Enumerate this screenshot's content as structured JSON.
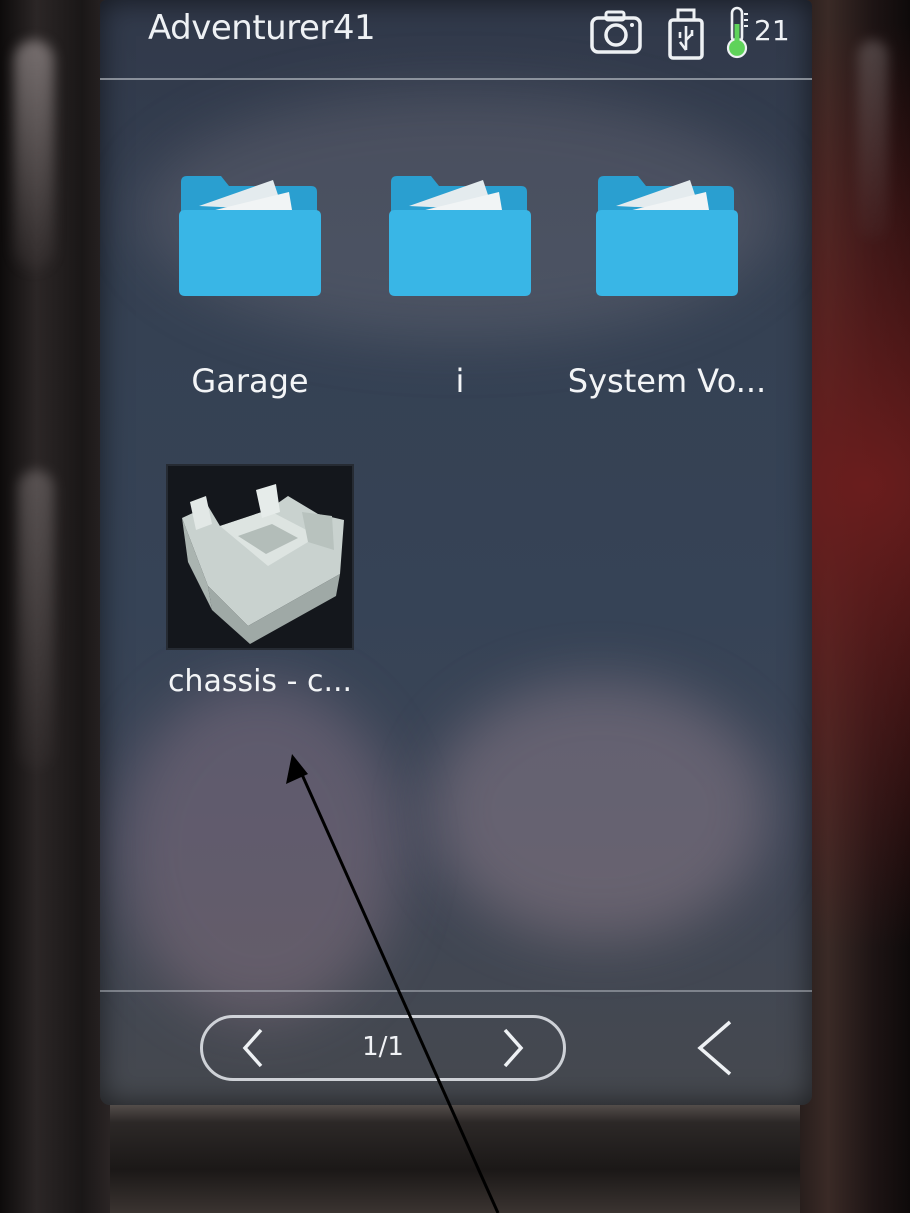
{
  "status_bar": {
    "device_name": "Adventurer41",
    "camera_icon": "camera-icon",
    "usb_icon": "usb-icon",
    "temperature_icon": "thermometer-icon",
    "temperature": "21"
  },
  "files": {
    "folders": [
      {
        "label": "Garage",
        "icon": "folder-icon"
      },
      {
        "label": "i",
        "icon": "folder-icon"
      },
      {
        "label": "System Vo...",
        "icon": "folder-icon"
      }
    ],
    "model_file": {
      "label": "chassis - c...",
      "icon": "model-thumbnail"
    }
  },
  "pagination": {
    "page": "1/1",
    "prev_icon": "chevron-left-icon",
    "next_icon": "chevron-right-icon"
  },
  "navigation": {
    "back_icon": "back-arrow-icon"
  },
  "colors": {
    "folder": "#39b6e6",
    "folder_dark": "#2a9fd0",
    "screen": "#364356",
    "text": "#eef1f4"
  }
}
